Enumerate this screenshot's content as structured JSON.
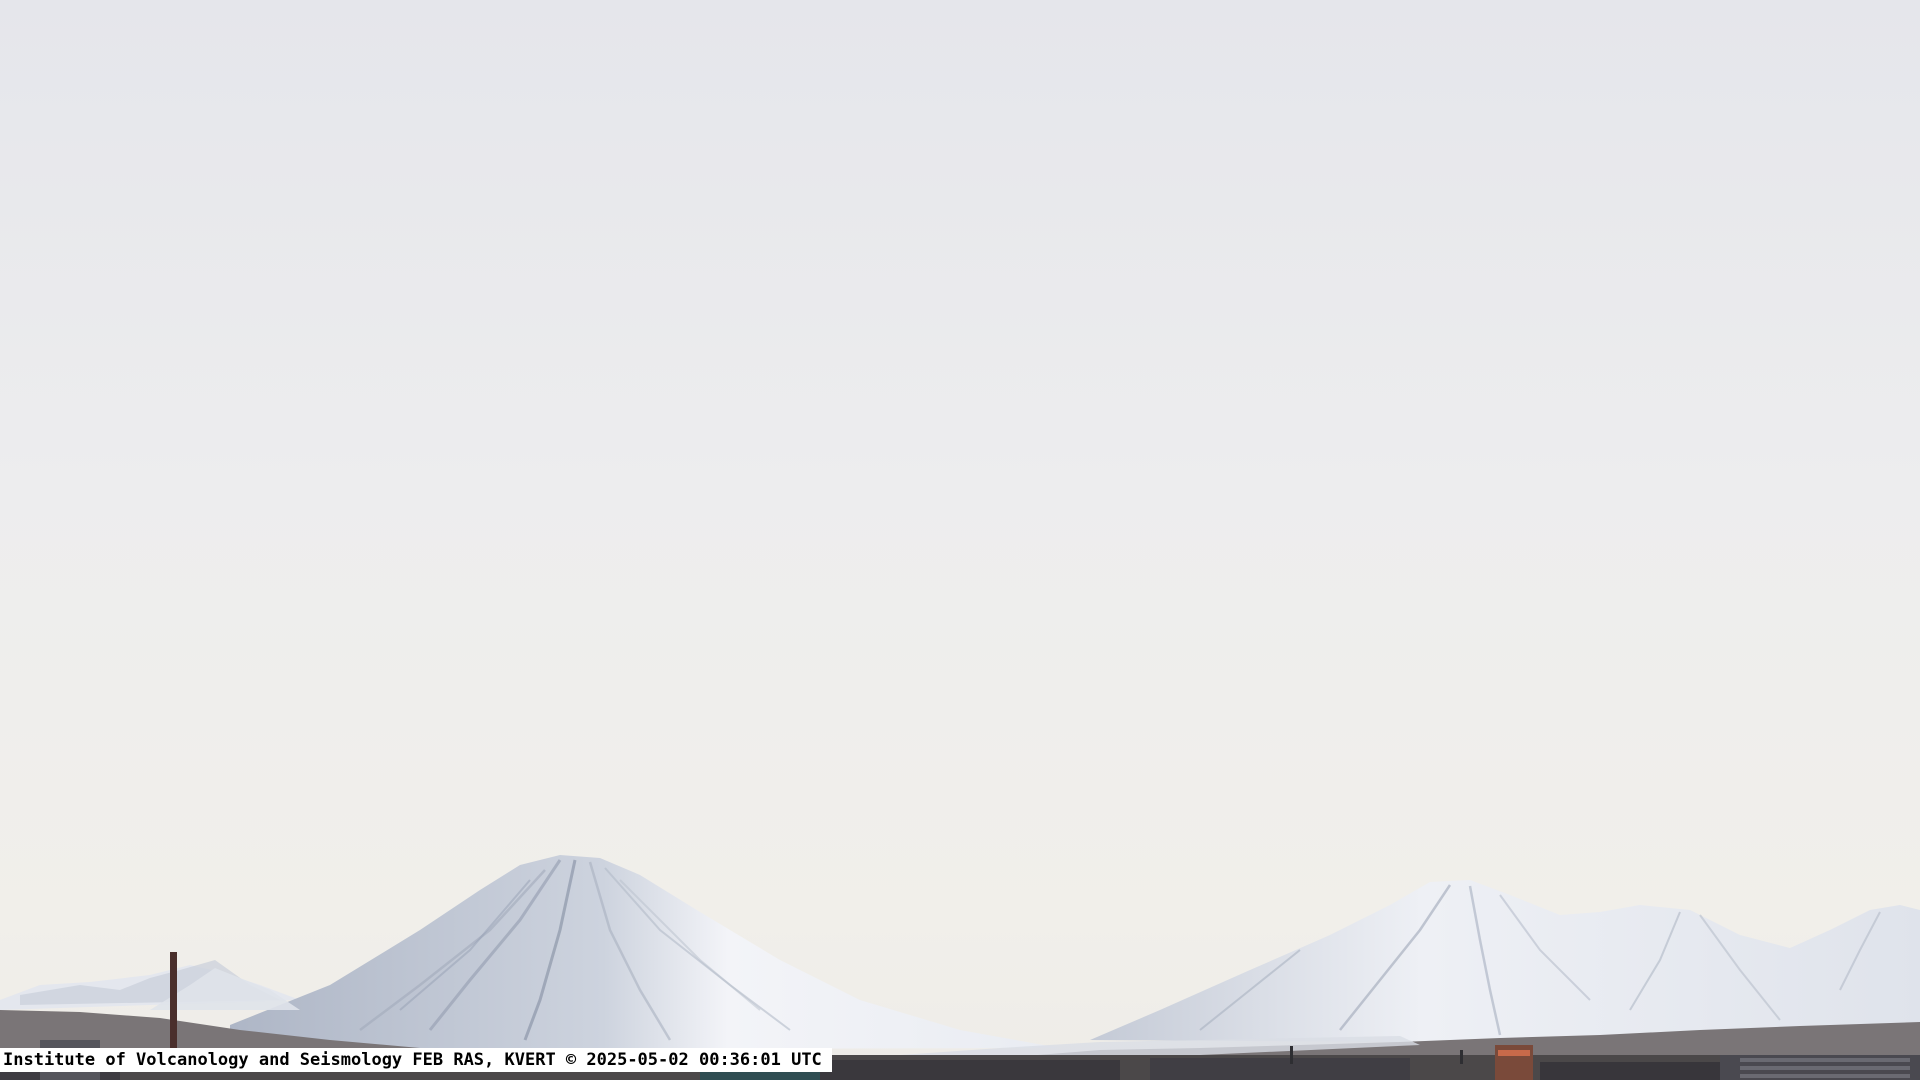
{
  "caption": {
    "text": "Institute of Volcanology and Seismology FEB RAS, KVERT © 2025-05-02 00:36:01 UTC"
  },
  "colors": {
    "sky_top": "#e6e7ec",
    "sky_mid": "#eeeeee",
    "sky_low": "#f1efeb",
    "snow": "#f4f5f8",
    "snow_shadow": "#bcc3d0",
    "ridge_dark": "#6f6a6c",
    "ground": "#4a4748",
    "city": "#3a3a40"
  },
  "scene": {
    "subjects": [
      "volcano-left",
      "volcano-right",
      "city-skyline",
      "smokestack"
    ]
  }
}
